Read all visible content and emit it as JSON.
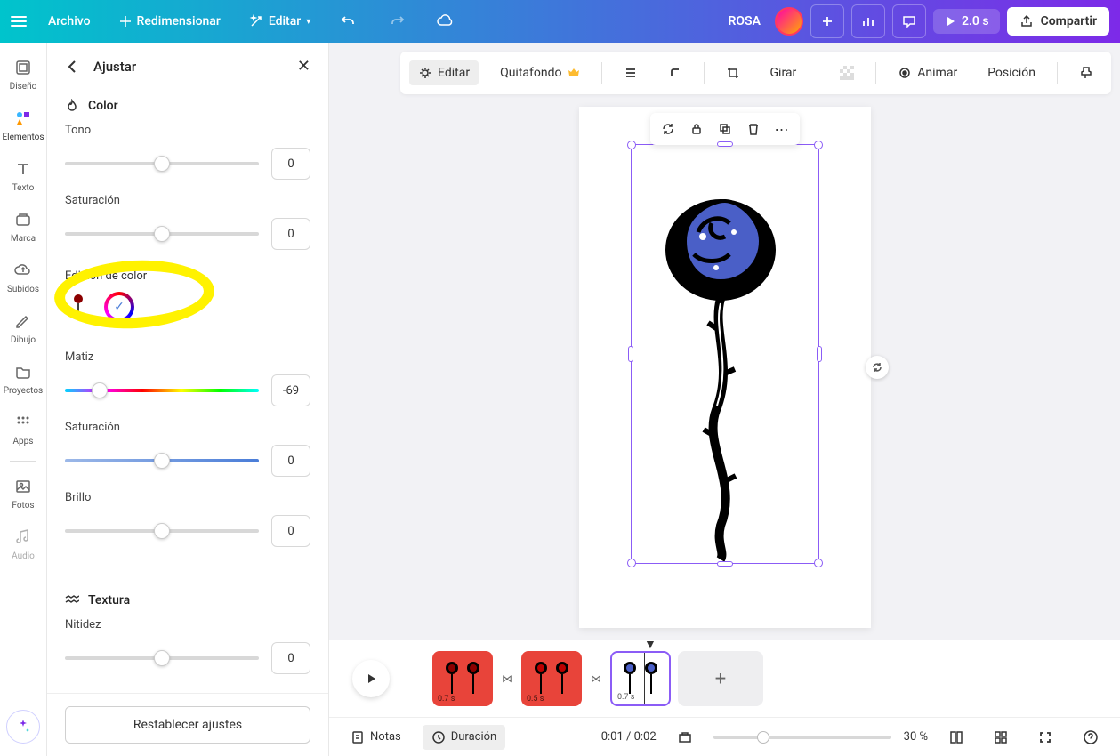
{
  "topbar": {
    "file": "Archivo",
    "resize": "Redimensionar",
    "edit": "Editar",
    "docTitle": "ROSA",
    "playDuration": "2.0 s",
    "share": "Compartir"
  },
  "sidebar": {
    "design": "Diseño",
    "elements": "Elementos",
    "text": "Texto",
    "brand": "Marca",
    "uploads": "Subidos",
    "draw": "Dibujo",
    "projects": "Proyectos",
    "apps": "Apps",
    "photos": "Fotos",
    "audio": "Audio"
  },
  "panel": {
    "title": "Ajustar",
    "color_section": "Color",
    "tone_label": "Tono",
    "tone_value": "0",
    "saturation_label": "Saturación",
    "saturation_value": "0",
    "color_edit_label": "Edición de color",
    "hue_label": "Matiz",
    "hue_value": "-69",
    "saturation2_label": "Saturación",
    "saturation2_value": "0",
    "brightness_label": "Brillo",
    "brightness_value": "0",
    "texture_section": "Textura",
    "sharpness_label": "Nitidez",
    "sharpness_value": "0",
    "reset": "Restablecer ajustes"
  },
  "canvasToolbar": {
    "edit": "Editar",
    "removeBg": "Quitafondo",
    "rotate": "Girar",
    "animate": "Animar",
    "position": "Posición"
  },
  "timeline": {
    "clip1_time": "0.7 s",
    "clip2_time": "0.5 s",
    "clip3_time": "0.7 s",
    "notes": "Notas",
    "duration": "Duración",
    "timecode": "0:01 / 0:02",
    "zoom": "30 %"
  }
}
